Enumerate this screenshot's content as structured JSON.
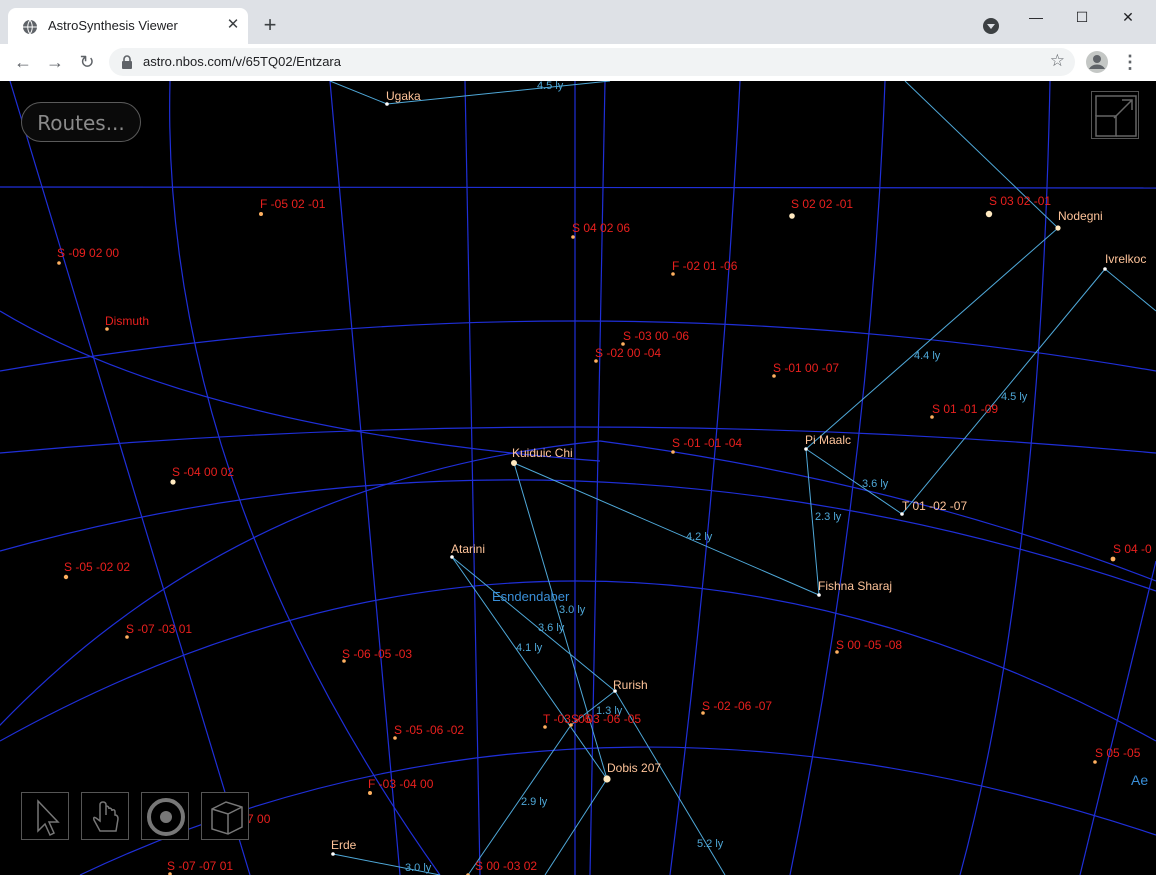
{
  "browser": {
    "tab_title": "AstroSynthesis Viewer",
    "tab_close": "✕",
    "new_tab": "+",
    "url": "astro.nbos.com/v/65TQ02/Entzara",
    "back": "←",
    "forward": "→",
    "reload": "↻",
    "star": "☆",
    "menu": "⋮",
    "minimize": "—",
    "maximize": "☐",
    "close": "✕"
  },
  "viewer": {
    "routes_label": "Routes...",
    "tools": [
      "pointer-tool",
      "hand-tool",
      "target-tool",
      "cube-tool"
    ]
  },
  "colors": {
    "grid": "#1f2fd8",
    "route": "#4fa8d8",
    "label_red": "#e8201e",
    "label_peach": "#ffc49a",
    "sector_label": "#3a8fd8"
  },
  "stars": [
    {
      "name": "Ugaka",
      "kind": "named"
    },
    {
      "name": "F -05 02 -01",
      "kind": "coord"
    },
    {
      "name": "S -09 02 00",
      "kind": "coord"
    },
    {
      "name": "Dismuth",
      "kind": "coord"
    },
    {
      "name": "S  04 02  06",
      "kind": "coord"
    },
    {
      "name": "F -02 01 -06",
      "kind": "coord"
    },
    {
      "name": "S 02 02 -01",
      "kind": "coord"
    },
    {
      "name": "S 03 02 -01",
      "kind": "coord"
    },
    {
      "name": "Nodegni",
      "kind": "named"
    },
    {
      "name": "Ivrelkoc",
      "kind": "named"
    },
    {
      "name": "S -03 00 -06",
      "kind": "coord"
    },
    {
      "name": "S -02 00 -04",
      "kind": "coord"
    },
    {
      "name": "S -01 00 -07",
      "kind": "coord"
    },
    {
      "name": "S 01 -01 -09",
      "kind": "coord"
    },
    {
      "name": "Kuiduic Chi",
      "kind": "named"
    },
    {
      "name": "S -01 -01 -04",
      "kind": "coord"
    },
    {
      "name": "Pi Maalc",
      "kind": "named"
    },
    {
      "name": "S -04 00 02",
      "kind": "coord"
    },
    {
      "name": "T 01 -02 -07",
      "kind": "named"
    },
    {
      "name": "S 04 -0",
      "kind": "coord"
    },
    {
      "name": "Atarini",
      "kind": "named"
    },
    {
      "name": "S -05 -02 02",
      "kind": "coord"
    },
    {
      "name": "Fishna Sharaj",
      "kind": "named"
    },
    {
      "name": "S -07 -03 01",
      "kind": "coord"
    },
    {
      "name": "S -06 -05 -03",
      "kind": "coord"
    },
    {
      "name": "S 00 -05 -08",
      "kind": "coord"
    },
    {
      "name": "Rurish",
      "kind": "named"
    },
    {
      "name": "S -02 -06 -07",
      "kind": "coord"
    },
    {
      "name": "T -03 -05",
      "kind": "coord"
    },
    {
      "name": "S -03 -06 -05",
      "kind": "coord"
    },
    {
      "name": "S -05 -06 -02",
      "kind": "coord"
    },
    {
      "name": "Dobis 207",
      "kind": "named"
    },
    {
      "name": "S 05 -05",
      "kind": "coord"
    },
    {
      "name": "F -03 -04 00",
      "kind": "coord"
    },
    {
      "name": "F -07 -07 00",
      "kind": "coord"
    },
    {
      "name": "Erde",
      "kind": "named"
    },
    {
      "name": "S -07 -07 01",
      "kind": "coord"
    },
    {
      "name": "S 00 -03 02",
      "kind": "coord"
    }
  ],
  "sector_labels": [
    {
      "text": "Esndendaber"
    },
    {
      "text": "Ae"
    }
  ],
  "routes": [
    {
      "label": "4.5 ly"
    },
    {
      "label": "4.4 ly"
    },
    {
      "label": "4.5 ly"
    },
    {
      "label": "3.6 ly"
    },
    {
      "label": "2.3 ly"
    },
    {
      "label": "4.2 ly"
    },
    {
      "label": "3.0 ly"
    },
    {
      "label": "3.6 ly"
    },
    {
      "label": "4.1 ly"
    },
    {
      "label": "1.3 ly"
    },
    {
      "label": "2.9 ly"
    },
    {
      "label": "5.2 ly"
    },
    {
      "label": "3.0 ly"
    }
  ]
}
